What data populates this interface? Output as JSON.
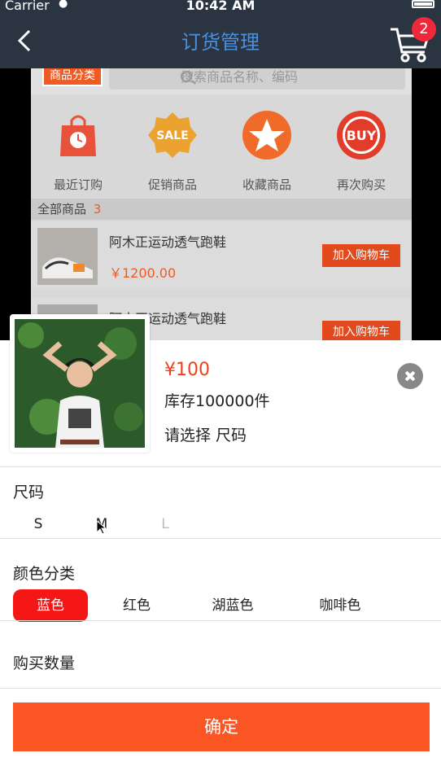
{
  "status_bar": {
    "carrier": "Carrier",
    "time": "10:42 AM"
  },
  "nav": {
    "title": "订货管理",
    "cart_badge": "2"
  },
  "background": {
    "category_button": "商品分类",
    "search_placeholder": "搜索商品名称、编码",
    "quick_links": [
      {
        "label": "最近订购",
        "icon": "shopping-bag-clock-icon"
      },
      {
        "label": "促销商品",
        "icon": "sale-badge-icon"
      },
      {
        "label": "收藏商品",
        "icon": "star-icon"
      },
      {
        "label": "再次购买",
        "icon": "buy-badge-icon"
      }
    ],
    "all_products_label": "全部商品",
    "all_products_count": "3",
    "products": [
      {
        "name": "阿木正运动透气跑鞋",
        "price": "￥1200.00",
        "add_label": "加入购物车"
      },
      {
        "name": "阿木正运动透气跑鞋",
        "price": "",
        "add_label": "加入购物车"
      }
    ]
  },
  "sheet": {
    "price": "¥100",
    "stock": "库存100000件",
    "select_hint": "请选择 尺码",
    "size_label": "尺码",
    "sizes": [
      "S",
      "M",
      "L"
    ],
    "color_label": "颜色分类",
    "colors": [
      "蓝色",
      "红色",
      "湖蓝色",
      "咖啡色"
    ],
    "selected_color": "蓝色",
    "quantity_label": "购买数量",
    "confirm_label": "确定"
  },
  "colors": {
    "accent": "#f05a23",
    "selected": "#f51616",
    "confirm": "#fa5522",
    "nav_bg": "#2b3441",
    "nav_title": "#4a90e2"
  }
}
